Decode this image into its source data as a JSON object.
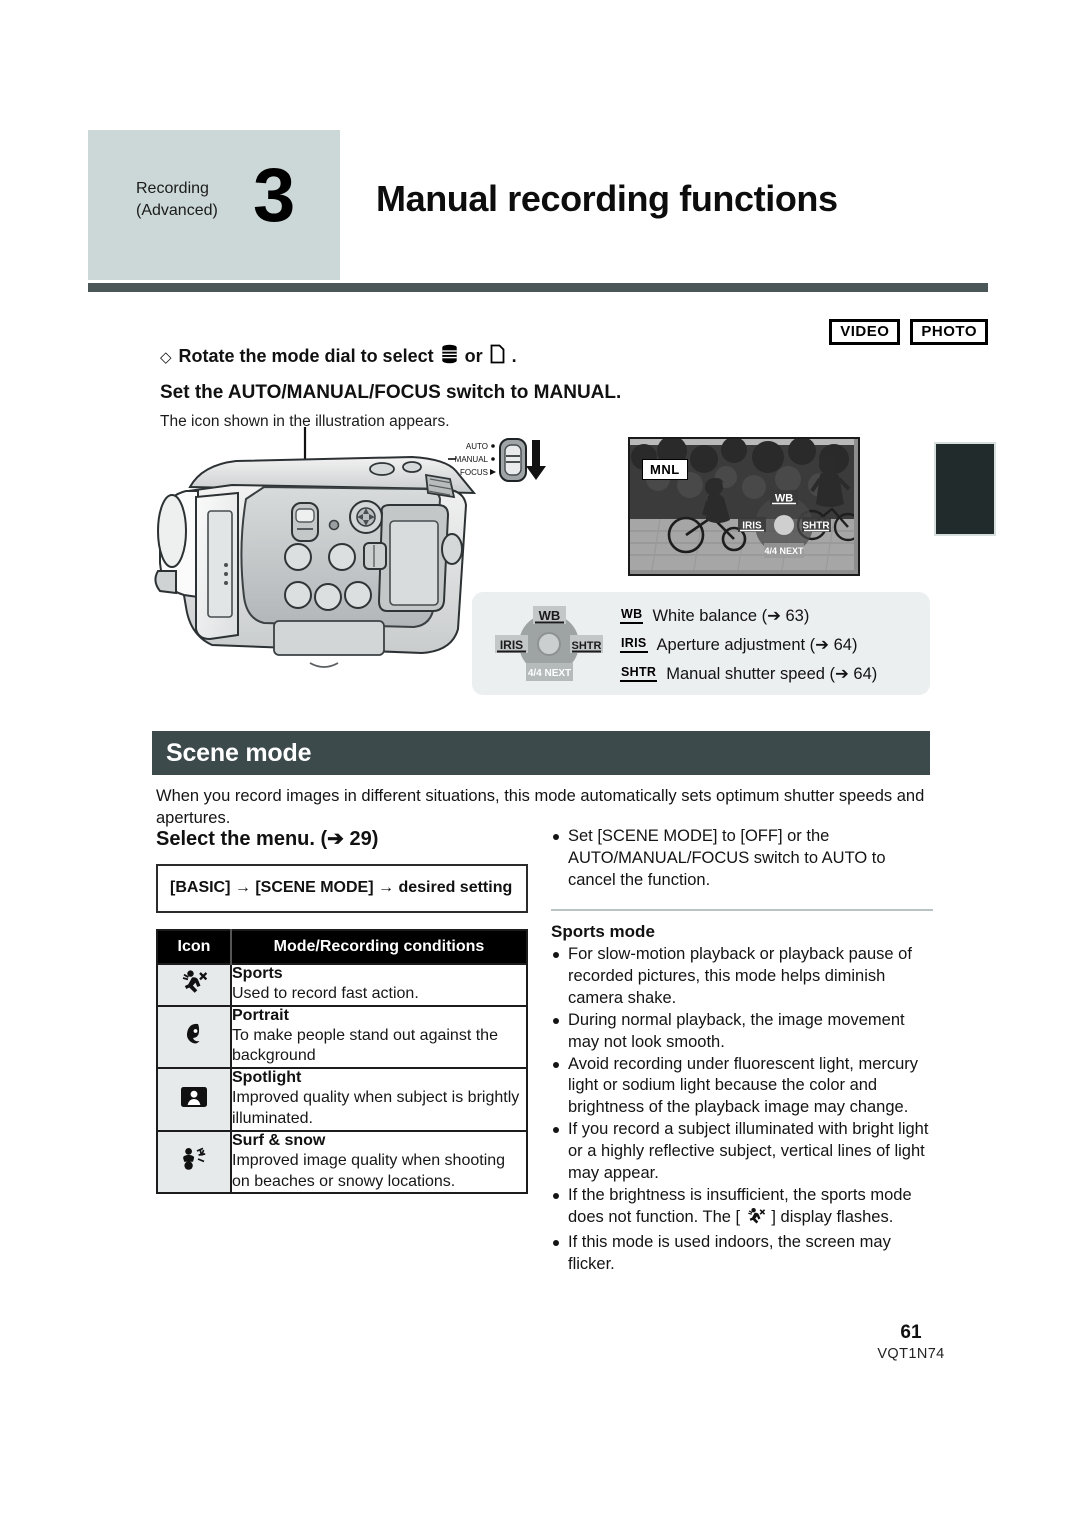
{
  "chapter": {
    "kicker_line1": "Recording",
    "kicker_line2": "(Advanced)",
    "number": "3",
    "title": "Manual recording functions"
  },
  "badges": [
    {
      "label": "VIDEO"
    },
    {
      "label": "PHOTO"
    }
  ],
  "intro": {
    "dial_prefix": "Rotate the mode dial to select",
    "dial_or": "or",
    "dial_suffix": ".",
    "diamond": "◇",
    "subhead": "Set the AUTO/MANUAL/FOCUS switch to MANUAL.",
    "note": "The icon shown in the illustration appears."
  },
  "switch": {
    "auto": "AUTO",
    "manual": "MANUAL",
    "focus": "FOCUS"
  },
  "lcd": {
    "mnl": "MNL",
    "pad_up": "WB",
    "pad_left": "IRIS",
    "pad_right": "SHTR",
    "pad_down": "4/4 NEXT"
  },
  "legend": {
    "pad_up": "WB",
    "pad_left": "IRIS",
    "pad_right": "SHTR",
    "pad_down": "4/4 NEXT",
    "items": [
      {
        "badge": "WB",
        "text": "White balance (➔ 63)"
      },
      {
        "badge": "IRIS",
        "text": "Aperture adjustment (➔ 64)"
      },
      {
        "badge": "SHTR",
        "text": "Manual shutter speed (➔ 64)"
      }
    ]
  },
  "scene": {
    "banner": "Scene mode",
    "description": "When you record images in different situations, this mode automatically sets optimum shutter speeds and apertures.",
    "select_menu": "Select the menu. (➔ 29)",
    "menu_path": "[BASIC] → [SCENE MODE] → desired setting",
    "table": {
      "headers": [
        "Icon",
        "Mode/Recording conditions"
      ],
      "rows": [
        {
          "icon": "sports-runner-icon",
          "name": "Sports",
          "desc": "Used to record fast action."
        },
        {
          "icon": "portrait-face-icon",
          "name": "Portrait",
          "desc": "To make people stand out against the background"
        },
        {
          "icon": "spotlight-icon",
          "name": "Spotlight",
          "desc": "Improved quality when subject is brightly illuminated."
        },
        {
          "icon": "surf-snow-icon",
          "name": "Surf & snow",
          "desc": "Improved image quality when shooting on beaches or snowy locations."
        }
      ]
    }
  },
  "notes": {
    "cancel_bullet": "Set [SCENE MODE] to [OFF] or the AUTO/MANUAL/FOCUS switch to AUTO to cancel the function.",
    "sports_heading": "Sports mode",
    "sports_bullets": [
      "For slow-motion playback or playback pause of recorded pictures, this mode helps diminish camera shake.",
      "During normal playback, the image movement may not look smooth.",
      "Avoid recording under fluorescent light, mercury light or sodium light because the color and brightness of the playback image may change.",
      "If you record a subject illuminated with bright light or a highly reflective subject, vertical lines of light may appear.",
      "If this mode is used indoors, the screen may flicker."
    ],
    "brightness_bullet_a": "If the brightness is insufficient, the sports mode does not function. The [",
    "brightness_bullet_b": "] display flashes."
  },
  "footer": {
    "page_number": "61",
    "doc_code": "VQT1N74"
  },
  "colors": {
    "chapter_tag_bg": "#ccd7d7",
    "rule": "#4a5658",
    "banner_bg": "#3d4a4c",
    "legend_bg": "#eceff0",
    "icon_cell_bg": "#e6eaeb"
  }
}
